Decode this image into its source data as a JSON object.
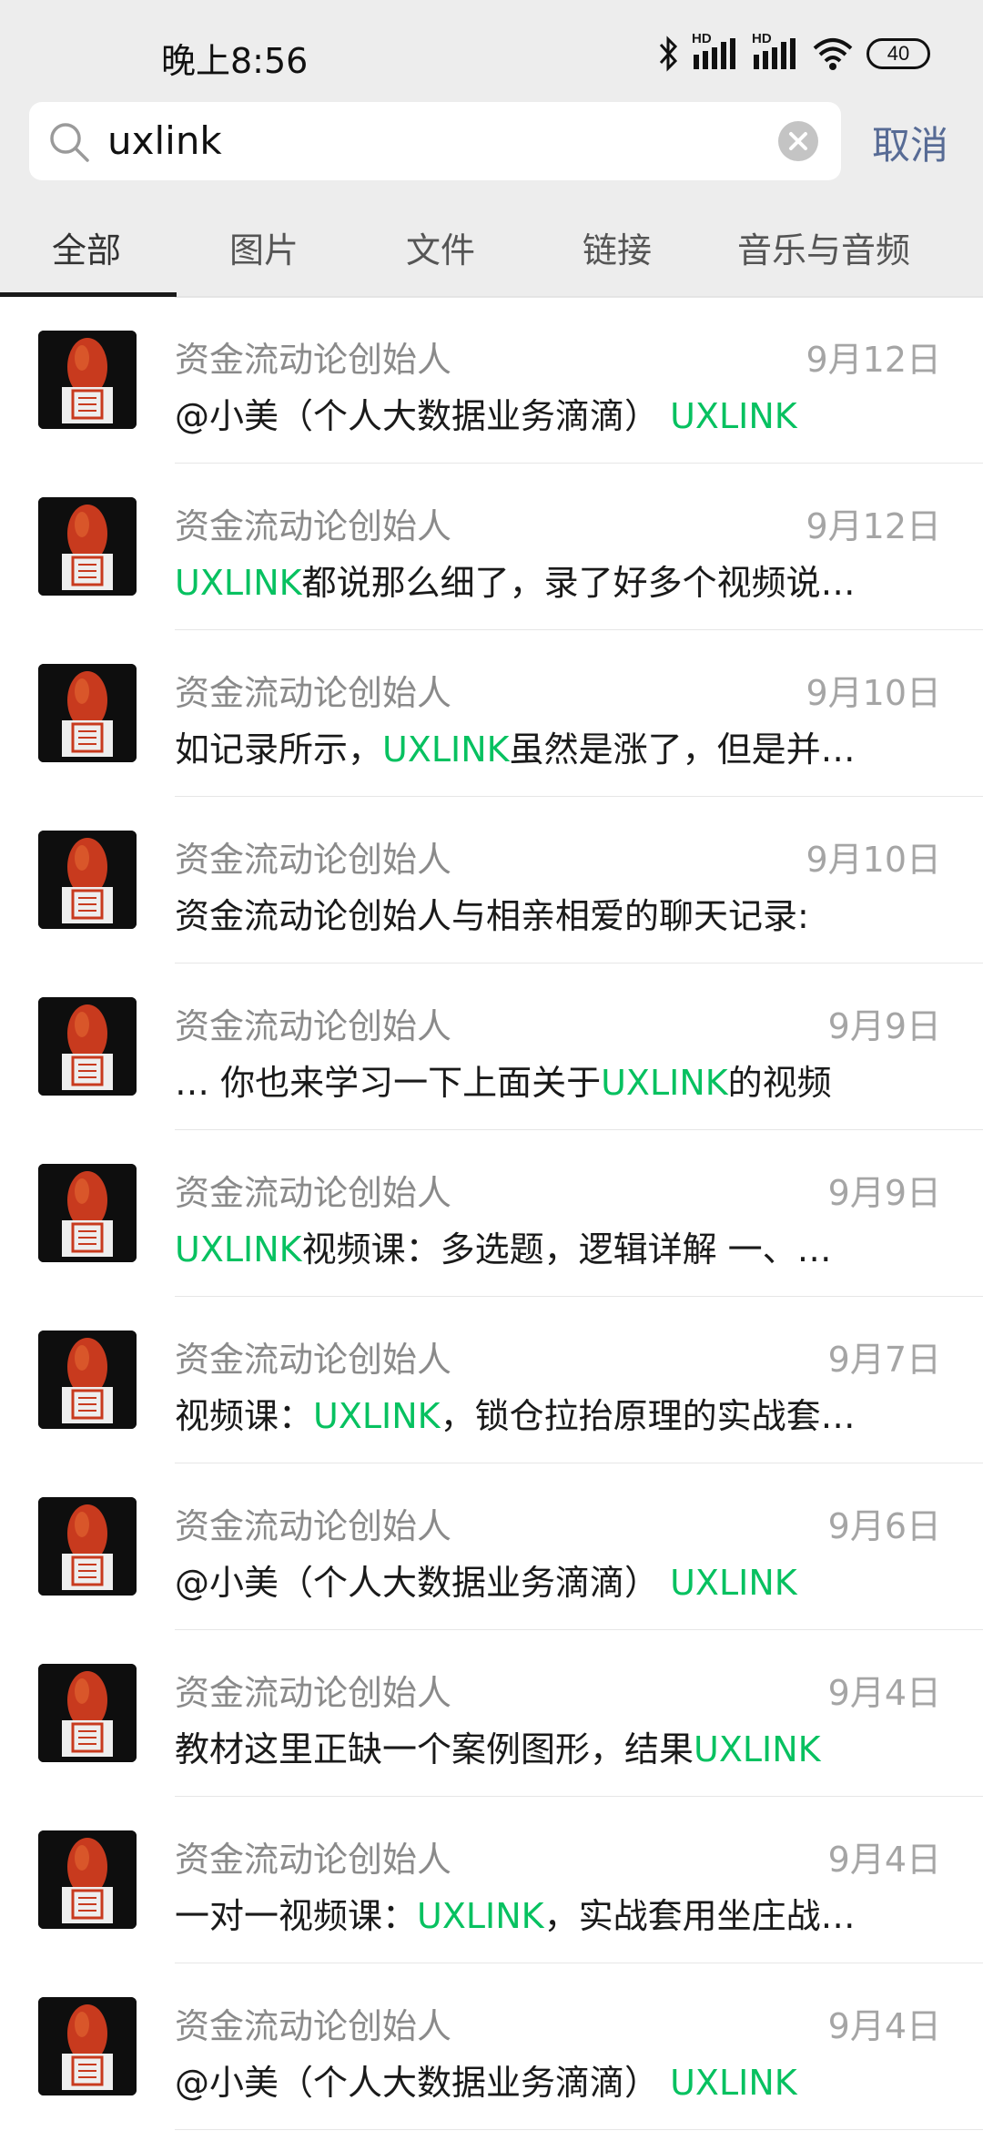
{
  "status_bar": {
    "time": "晚上8:56",
    "network_1": "HD",
    "network_2": "HD",
    "battery": "40"
  },
  "search": {
    "query": "uxlink",
    "cancel_label": "取消"
  },
  "tabs": [
    {
      "label": "全部",
      "active": true
    },
    {
      "label": "图片",
      "active": false
    },
    {
      "label": "文件",
      "active": false
    },
    {
      "label": "链接",
      "active": false
    },
    {
      "label": "音乐与音频",
      "active": false
    }
  ],
  "colors": {
    "highlight": "#07c160",
    "cancel": "#576b95",
    "header_bg": "#ededed"
  },
  "results": [
    {
      "sender": "资金流动论创始人",
      "date": "9月12日",
      "pre": "@小美（个人大数据业务滴滴） ",
      "hl": "UXLINK",
      "post": ""
    },
    {
      "sender": "资金流动论创始人",
      "date": "9月12日",
      "pre": "",
      "hl": "UXLINK",
      "post": "都说那么细了，录了好多个视频说…"
    },
    {
      "sender": "资金流动论创始人",
      "date": "9月10日",
      "pre": "如记录所示，",
      "hl": "UXLINK",
      "post": "虽然是涨了，但是并…"
    },
    {
      "sender": "资金流动论创始人",
      "date": "9月10日",
      "pre": "资金流动论创始人与相亲相爱的聊天记录:",
      "hl": "",
      "post": ""
    },
    {
      "sender": "资金流动论创始人",
      "date": "9月9日",
      "pre": "… 你也来学习一下上面关于",
      "hl": "UXLINK",
      "post": "的视频"
    },
    {
      "sender": "资金流动论创始人",
      "date": "9月9日",
      "pre": "",
      "hl": "UXLINK",
      "post": "视频课：多选题，逻辑详解 一、…"
    },
    {
      "sender": "资金流动论创始人",
      "date": "9月7日",
      "pre": "视频课：",
      "hl": "UXLINK",
      "post": "，锁仓拉抬原理的实战套…"
    },
    {
      "sender": "资金流动论创始人",
      "date": "9月6日",
      "pre": "@小美（个人大数据业务滴滴） ",
      "hl": "UXLINK",
      "post": ""
    },
    {
      "sender": "资金流动论创始人",
      "date": "9月4日",
      "pre": "教材这里正缺一个案例图形，结果",
      "hl": "UXLINK",
      "post": ""
    },
    {
      "sender": "资金流动论创始人",
      "date": "9月4日",
      "pre": "一对一视频课：",
      "hl": "UXLINK",
      "post": "，实战套用坐庄战…"
    },
    {
      "sender": "资金流动论创始人",
      "date": "9月4日",
      "pre": "@小美（个人大数据业务滴滴） ",
      "hl": "UXLINK",
      "post": ""
    }
  ]
}
